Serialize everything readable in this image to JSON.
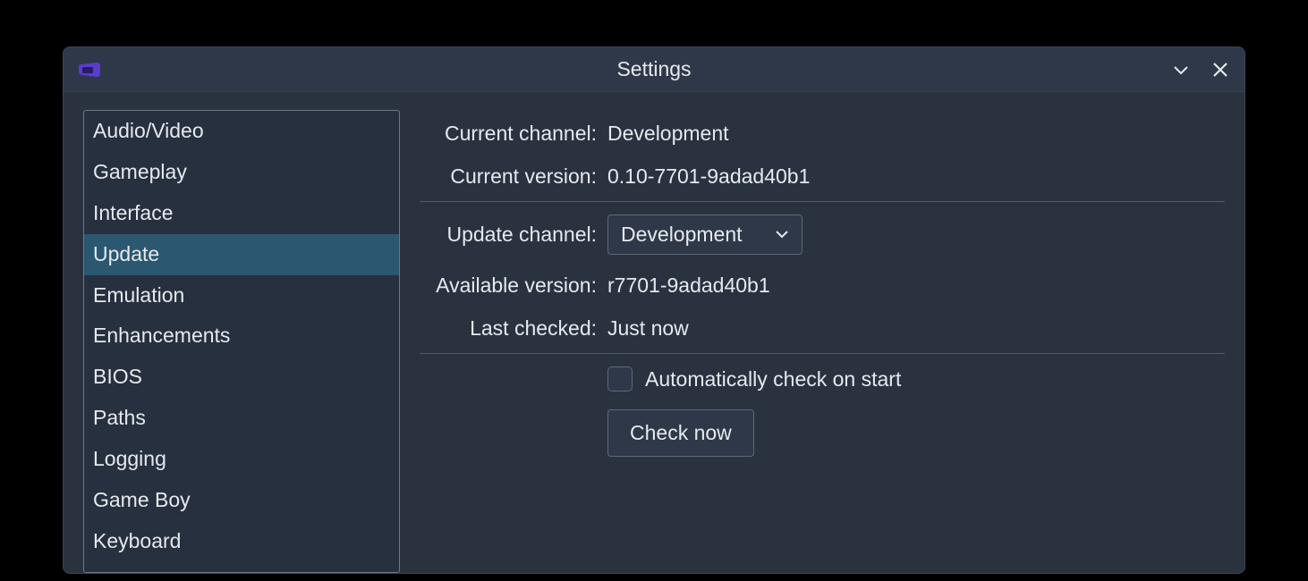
{
  "window": {
    "title": "Settings"
  },
  "sidebar": {
    "items": [
      {
        "label": "Audio/Video",
        "selected": false
      },
      {
        "label": "Gameplay",
        "selected": false
      },
      {
        "label": "Interface",
        "selected": false
      },
      {
        "label": "Update",
        "selected": true
      },
      {
        "label": "Emulation",
        "selected": false
      },
      {
        "label": "Enhancements",
        "selected": false
      },
      {
        "label": "BIOS",
        "selected": false
      },
      {
        "label": "Paths",
        "selected": false
      },
      {
        "label": "Logging",
        "selected": false
      },
      {
        "label": "Game Boy",
        "selected": false
      },
      {
        "label": "Keyboard",
        "selected": false
      }
    ]
  },
  "update": {
    "current_channel_label": "Current channel:",
    "current_channel_value": "Development",
    "current_version_label": "Current version:",
    "current_version_value": "0.10-7701-9adad40b1",
    "update_channel_label": "Update channel:",
    "update_channel_value": "Development",
    "available_version_label": "Available version:",
    "available_version_value": "r7701-9adad40b1",
    "last_checked_label": "Last checked:",
    "last_checked_value": "Just now",
    "auto_check_label": "Automatically check on start",
    "auto_check_checked": false,
    "check_now_label": "Check now"
  }
}
